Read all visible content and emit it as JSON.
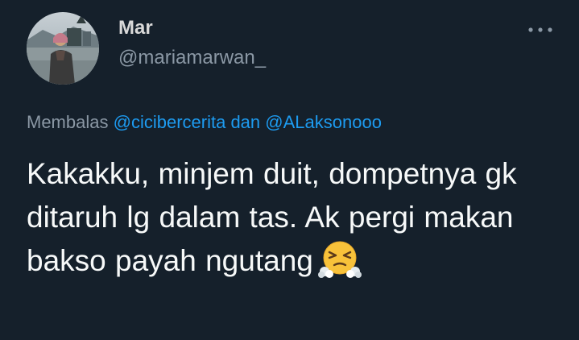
{
  "tweet": {
    "author": {
      "display_name": "Mar",
      "handle": "@mariamarwan_",
      "avatar_icon": "profile-photo"
    },
    "more_icon": "more-horizontal-icon",
    "reply": {
      "prefix": "Membalas",
      "mention_1": "@cicibercerita",
      "connector": "dan",
      "mention_2": "@ALaksonooo"
    },
    "text": "Kakakku, minjem duit, dompetnya gk ditaruh lg dalam tas. Ak pergi makan bakso payah ngutang",
    "emoji_icon": "face-with-steam-from-nose-emoji"
  },
  "colors": {
    "background": "#15202b",
    "primary_text": "#f7f9f9",
    "secondary_text": "#8b98a5",
    "accent": "#1d9bf0"
  }
}
